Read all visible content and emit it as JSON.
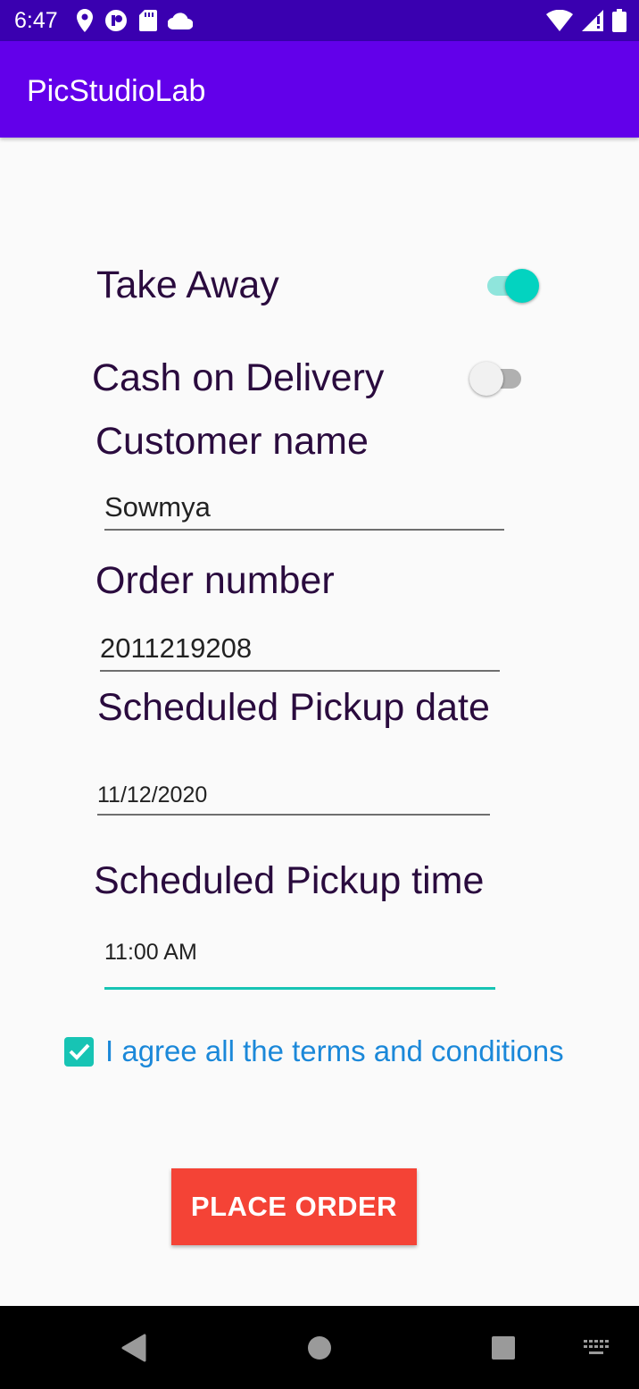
{
  "status_bar": {
    "time": "6:47",
    "left_icons": [
      "location-icon",
      "app-notification-icon",
      "sd-card-icon",
      "cloud-icon"
    ],
    "right_icons": [
      "wifi-icon",
      "signal-icon",
      "battery-icon"
    ]
  },
  "app_bar": {
    "title": "PicStudioLab",
    "color": "#6200ea"
  },
  "form": {
    "take_away": {
      "label": "Take Away",
      "checked": true
    },
    "cash_on_delivery": {
      "label": "Cash on Delivery",
      "checked": false
    },
    "customer_name": {
      "label": "Customer name",
      "value": "Sowmya"
    },
    "order_number": {
      "label": "Order number",
      "value": "2011219208"
    },
    "pickup_date": {
      "label": "Scheduled Pickup date",
      "value": "11/12/2020"
    },
    "pickup_time": {
      "label": "Scheduled Pickup time",
      "value": "11:00 AM"
    },
    "terms": {
      "label": "I agree all the terms and conditions",
      "checked": true
    },
    "place_order_label": "PLACE ORDER"
  },
  "colors": {
    "accent": "#03d3c0",
    "button": "#f44336",
    "link": "#1b88d9"
  },
  "nav_bar": {
    "icons": [
      "back-icon",
      "home-icon",
      "recents-icon",
      "keyboard-icon"
    ]
  }
}
